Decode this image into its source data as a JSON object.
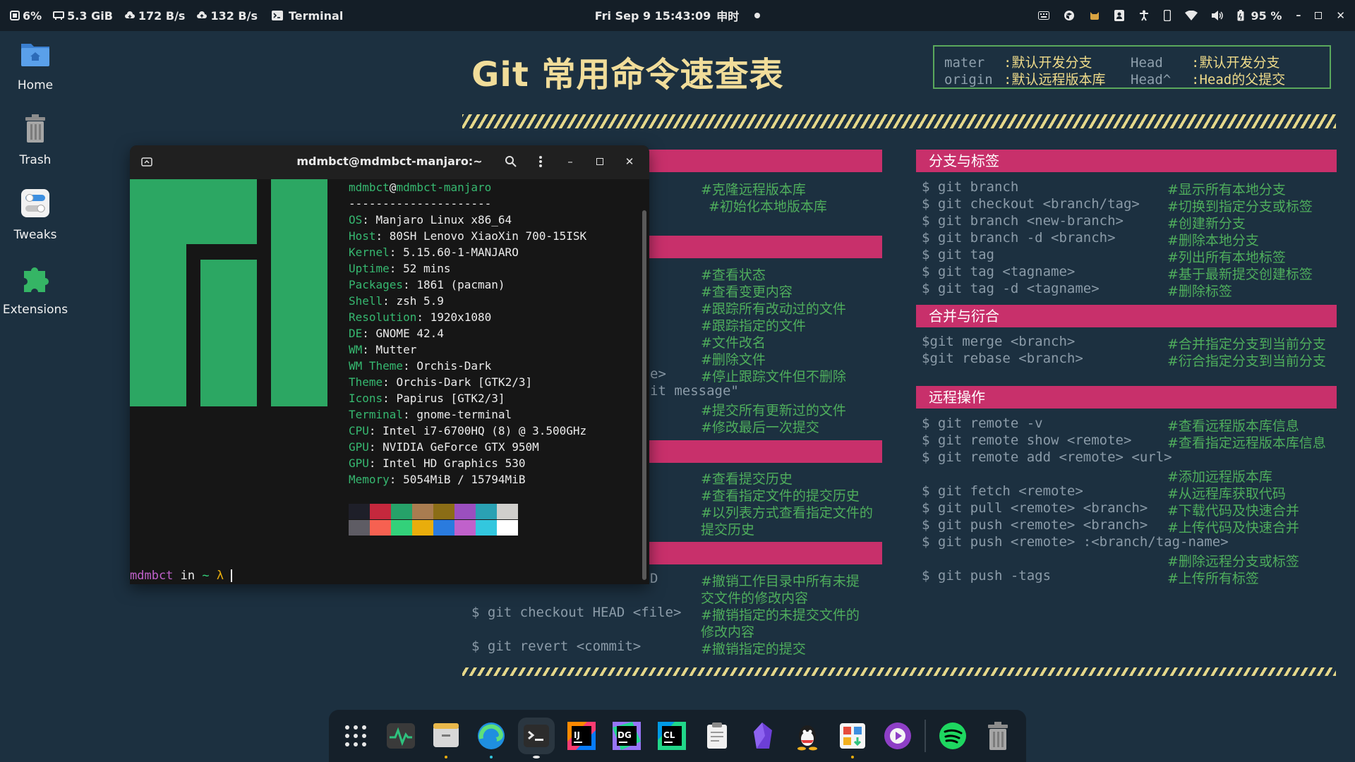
{
  "topbar": {
    "cpu": "6%",
    "memory": "5.3 GiB",
    "net_down": "172 B/s",
    "net_up": "132 B/s",
    "active_app": "Terminal",
    "clock": "Fri Sep 9  15:43:09",
    "clock_extra": "申时",
    "battery": "95 %"
  },
  "desktop": {
    "icons": [
      {
        "label": "Home"
      },
      {
        "label": "Trash"
      },
      {
        "label": "Tweaks"
      },
      {
        "label": "Extensions"
      }
    ]
  },
  "cheatsheet": {
    "title": "Git 常用命令速查表",
    "legend": {
      "r1k1": "mater",
      "r1v1": ":默认开发分支",
      "r1k2": "Head",
      "r1v2": ":默认开发分支",
      "r2k1": "origin",
      "r2v1": ":默认远程版本库",
      "r2k2": "Head^",
      "r2v2": ":Head的父提交"
    },
    "left_comments": [
      "#克隆远程版本库",
      "#初始化本地版本库",
      "#查看状态",
      "#查看变更内容",
      "#跟踪所有改动过的文件",
      "#跟踪指定的文件",
      "#文件改名",
      "#删除文件",
      "#停止跟踪文件但不删除",
      "#提交所有更新过的文件",
      "#修改最后一次提交",
      "#查看提交历史",
      "#查看指定文件的提交历史",
      "#以列表方式查看指定文件的",
      "提交历史",
      "#撤销工作目录中所有未提",
      "交文件的修改内容",
      "#撤销指定的未提交文件的",
      "修改内容",
      "#撤销指定的提交"
    ],
    "left_fragments": {
      "frag1": "e>",
      "frag2": "it message\"",
      "frag3": "D"
    },
    "left_cmds": {
      "c1": "$ git checkout HEAD <file>",
      "c2": "$ git revert <commit>"
    },
    "branch": {
      "title": "分支与标签",
      "rows": [
        {
          "cmd": "$ git branch",
          "cmt": "#显示所有本地分支"
        },
        {
          "cmd": "$ git checkout <branch/tag>",
          "cmt": "#切换到指定分支或标签"
        },
        {
          "cmd": "$ git branch <new-branch>",
          "cmt": "#创建新分支"
        },
        {
          "cmd": "$ git branch -d <branch>",
          "cmt": "#删除本地分支"
        },
        {
          "cmd": "$ git tag",
          "cmt": "#列出所有本地标签"
        },
        {
          "cmd": "$ git tag <tagname>",
          "cmt": "#基于最新提交创建标签"
        },
        {
          "cmd": "$ git tag -d <tagname>",
          "cmt": "#删除标签"
        }
      ]
    },
    "merge": {
      "title": "合并与衍合",
      "rows": [
        {
          "cmd": "$git merge <branch>",
          "cmt": "#合并指定分支到当前分支"
        },
        {
          "cmd": "$git rebase <branch>",
          "cmt": "#衍合指定分支到当前分支"
        }
      ]
    },
    "remote": {
      "title": "远程操作",
      "rows": [
        {
          "cmd": "$ git remote -v",
          "cmt": "#查看远程版本库信息"
        },
        {
          "cmd": "$ git remote show <remote>",
          "cmt": "#查看指定远程版本库信息"
        },
        {
          "cmd": "$ git remote add <remote> <url>",
          "cmt": ""
        },
        {
          "cmd": "",
          "cmt": "#添加远程版本库"
        },
        {
          "cmd": "$ git fetch <remote>",
          "cmt": "#从远程库获取代码"
        },
        {
          "cmd": "$ git pull <remote> <branch>",
          "cmt": "#下载代码及快速合并"
        },
        {
          "cmd": "$ git push <remote> <branch>",
          "cmt": "#上传代码及快速合并"
        },
        {
          "cmd": "$ git push <remote> :<branch/tag-name>",
          "cmt": ""
        },
        {
          "cmd": "",
          "cmt": "#删除远程分支或标签"
        },
        {
          "cmd": "$ git push -tags",
          "cmt": "#上传所有标签"
        }
      ]
    }
  },
  "terminal": {
    "title": "mdmbct@mdmbct-manjaro:~",
    "user": "mdmbct",
    "at": "@",
    "host": "mdmbct-manjaro",
    "separator": "---------------------",
    "info": [
      {
        "key": "OS",
        "value": "Manjaro Linux x86_64"
      },
      {
        "key": "Host",
        "value": "80SH Lenovo XiaoXin 700-15ISK"
      },
      {
        "key": "Kernel",
        "value": "5.15.60-1-MANJARO"
      },
      {
        "key": "Uptime",
        "value": "52 mins"
      },
      {
        "key": "Packages",
        "value": "1861 (pacman)"
      },
      {
        "key": "Shell",
        "value": "zsh 5.9"
      },
      {
        "key": "Resolution",
        "value": "1920x1080"
      },
      {
        "key": "DE",
        "value": "GNOME 42.4"
      },
      {
        "key": "WM",
        "value": "Mutter"
      },
      {
        "key": "WM Theme",
        "value": "Orchis-Dark"
      },
      {
        "key": "Theme",
        "value": "Orchis-Dark [GTK2/3]"
      },
      {
        "key": "Icons",
        "value": "Papirus [GTK2/3]"
      },
      {
        "key": "Terminal",
        "value": "gnome-terminal"
      },
      {
        "key": "CPU",
        "value": "Intel i7-6700HQ (8) @ 3.500GHz"
      },
      {
        "key": "GPU",
        "value": "NVIDIA GeForce GTX 950M"
      },
      {
        "key": "GPU",
        "value": "Intel HD Graphics 530"
      },
      {
        "key": "Memory",
        "value": "5054MiB / 15794MiB"
      }
    ],
    "colon": ": ",
    "palette_top": [
      "#1e1f29",
      "#c5283d",
      "#26a269",
      "#a97c50",
      "#8b6d16",
      "#9b4fbf",
      "#2aa1b3",
      "#d0cfcc"
    ],
    "palette_bottom": [
      "#5e5c64",
      "#f66151",
      "#33d17a",
      "#e9ad0c",
      "#2a7bde",
      "#c061cb",
      "#33c7de",
      "#ffffff"
    ],
    "prompt_user": "mdmbct",
    "prompt_in": " in ",
    "prompt_dir": "~",
    "prompt_symbol": " λ "
  },
  "dock": {
    "apps": [
      {
        "name": "app-grid-icon"
      },
      {
        "name": "system-monitor-icon"
      },
      {
        "name": "files-icon"
      },
      {
        "name": "edge-browser-icon"
      },
      {
        "name": "terminal-icon"
      },
      {
        "name": "intellij-idea-icon"
      },
      {
        "name": "datagrip-icon"
      },
      {
        "name": "clion-icon"
      },
      {
        "name": "clipboard-notes-icon"
      },
      {
        "name": "obsidian-icon"
      },
      {
        "name": "qq-icon"
      },
      {
        "name": "software-store-icon"
      },
      {
        "name": "media-player-icon"
      },
      {
        "name": "spotify-icon"
      },
      {
        "name": "trash-icon"
      }
    ]
  }
}
